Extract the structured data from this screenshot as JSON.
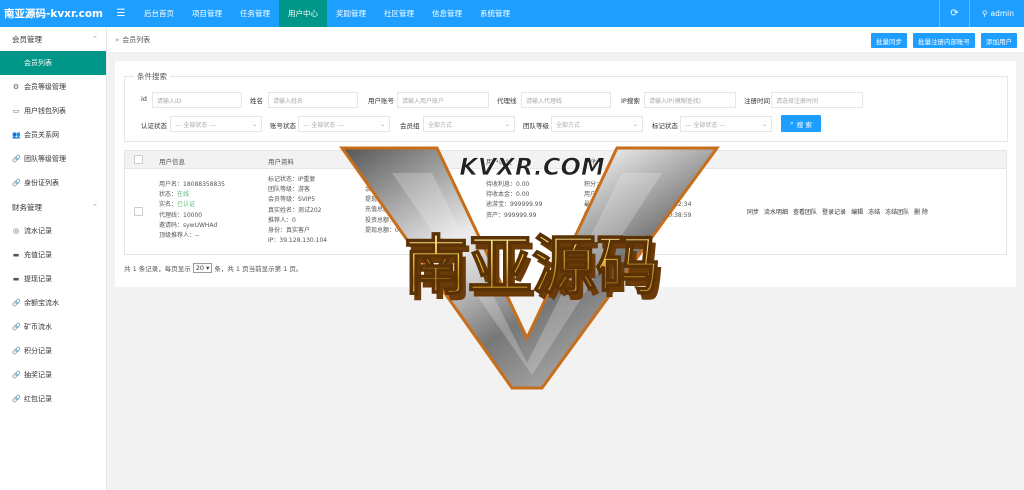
{
  "brand": "南亚源码-kvxr.com",
  "nav": [
    "后台首页",
    "项目管理",
    "任务管理",
    "用户中心",
    "奖励管理",
    "社区管理",
    "信息管理",
    "系统管理"
  ],
  "nav_active": 3,
  "user": "admin",
  "sidebar": {
    "group1": "会员管理",
    "group1_items": [
      "会员列表",
      "会员等级管理",
      "用户钱包列表",
      "会员关系网",
      "团队等级管理",
      "身份证列表"
    ],
    "group2": "财务管理",
    "group2_items": [
      "流水记录",
      "充值记录",
      "提现记录",
      "余额宝流水",
      "矿币流水",
      "积分记录",
      "抽奖记录",
      "红包记录"
    ]
  },
  "breadcrumb": "会员列表",
  "actions": [
    "批量同步",
    "批量注册内部账号",
    "添加用户"
  ],
  "filter": {
    "legend": "条件搜索",
    "id_label": "id",
    "id_ph": "请输入ID",
    "name_label": "姓名",
    "name_ph": "请输入姓名",
    "account_label": "用户账号",
    "account_ph": "请输入用户账户",
    "agent_label": "代理线",
    "agent_ph": "请输入代理线",
    "ip_label": "IP搜索",
    "ip_ph": "请输入IP(模糊查找)",
    "regtime_label": "注册时间",
    "regtime_ph": "请选择注册时间",
    "auth_label": "认证状态",
    "auth_val": "--- 全部状态 ---",
    "accstatus_label": "账号状态",
    "accstatus_val": "--- 全部状态 ---",
    "group_label": "会员组",
    "group_val": "全部方式",
    "team_label": "团队等级",
    "team_val": "全部方式",
    "tag_label": "标记状态",
    "tag_val": "--- 全部状态 ---",
    "search_btn": "搜 索"
  },
  "table": {
    "headers": [
      "用户信息",
      "用户资料",
      "用户余额(余额宝余额)",
      "用户收益",
      "其他"
    ],
    "row": {
      "info": [
        "用户名：18088358835",
        "状态：",
        "在线",
        "实名：",
        "已认证",
        "代理线：10000",
        "邀请码：sywUWHAd",
        "顶级推荐人：--"
      ],
      "profile": [
        "标记状态：IP重复",
        "团队等级：游客",
        "会员等级：SVIP5",
        "真实姓名：测试202",
        "推荐人：0",
        "身份：真实客户",
        "IP：39.128.130.104"
      ],
      "balance": [
        "余额：999999.99",
        "提现金额：0.00",
        "充值总额：1539997.11",
        "投资总额：0.00",
        "提现总额：0.00"
      ],
      "earnings": [
        "",
        "待收利息：0.00",
        "待收本金：0.00",
        "途游宝：999999.99",
        "资产：999999.99"
      ],
      "other": [
        "积分：1000000",
        "用户状态：",
        "正常",
        "最近操作：2024年08月01日 20:22:34",
        "注册时间：2023年08月07日 20:38:59"
      ],
      "ops": [
        "同步",
        "流水明细",
        "查看团队",
        "登录记录",
        "编辑",
        "冻结",
        "冻结团队",
        "删 除"
      ]
    }
  },
  "pager": {
    "prefix": "共 1 条记录，每页显示",
    "size": "20",
    "suffix": "条，共 1 页当前显示第 1 页。"
  },
  "watermark": {
    "top": "KVXR.COM",
    "main": "南亚源码"
  }
}
